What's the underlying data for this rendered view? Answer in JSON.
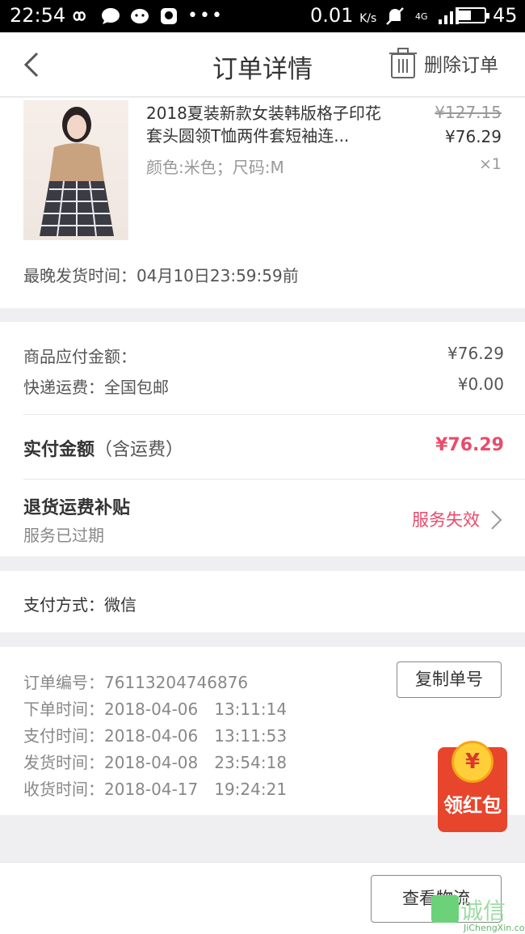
{
  "status_bar": {
    "time": "22:54",
    "speed": "0.01",
    "speed_unit": "K/s",
    "network": "4G",
    "battery": "45"
  },
  "nav": {
    "title": "订单详情",
    "delete_label": "删除订单"
  },
  "product": {
    "title": "2018夏装新款女装韩版格子印花套头圆领T恤两件套短袖连...",
    "spec": "颜色:米色；尺码:M",
    "original_price": "¥127.15",
    "price": "¥76.29",
    "quantity": "×1",
    "ship_deadline": "最晚发货时间：04月10日23:59:59前"
  },
  "payment_summary": {
    "goods_label": "商品应付金额：",
    "goods_value": "¥76.29",
    "shipping_label": "快递运费：全国包邮",
    "shipping_value": "¥0.00",
    "paid_label": "实付金额",
    "paid_note": "（含运费）",
    "paid_value": "¥76.29",
    "refund_label": "退货运费补贴",
    "refund_sub": "服务已过期",
    "refund_status": "服务失效"
  },
  "pay_method": "支付方式：微信",
  "order_info": {
    "order_no": "订单编号：76113204746876",
    "order_time": "下单时间：2018-04-06　13:11:14",
    "pay_time": "支付时间：2018-04-06　13:11:53",
    "ship_time": "发货时间：2018-04-08　23:54:18",
    "receive_time": "收货时间：2018-04-17　19:24:21",
    "copy_label": "复制单号"
  },
  "red_packet": {
    "coin": "¥",
    "label": "领红包"
  },
  "footer": {
    "logistics_label": "查看物流"
  },
  "watermark": {
    "name": "诚信",
    "url": "JiChengXin.com"
  },
  "colors": {
    "accent": "#e94b6b",
    "red_packet": "#e8452d",
    "background": "#efeff1"
  }
}
